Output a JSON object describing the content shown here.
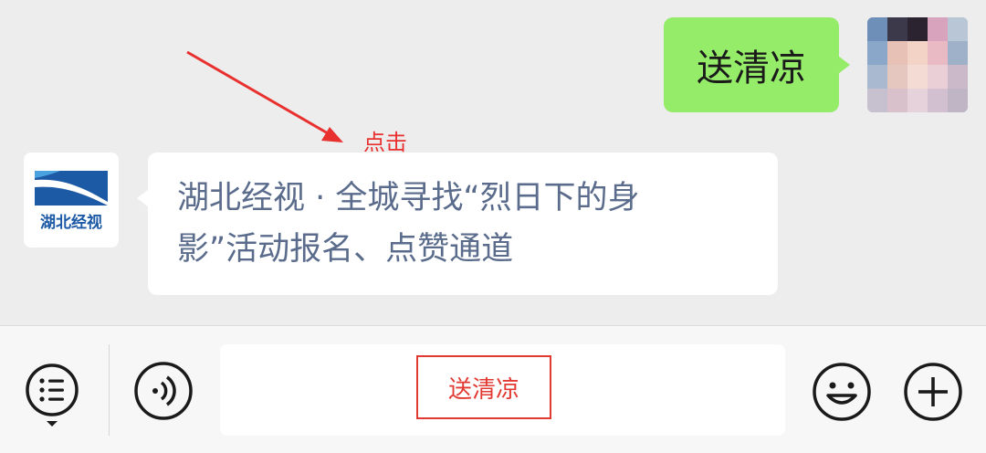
{
  "chat": {
    "outgoing_message": "送清凉",
    "incoming_message_line1": "湖北经视 · 全城寻找“烈日下的身",
    "incoming_message_line2": "影”活动报名、点赞通道",
    "official_account_logo_text": "湖北经视"
  },
  "annotation": {
    "label": "点击",
    "color": "#e8312f"
  },
  "input": {
    "value": "送清凉"
  },
  "colors": {
    "background": "#ededed",
    "outgoing_bubble": "#95ec69",
    "incoming_bubble": "#ffffff",
    "link_text": "#5a6b8c"
  },
  "icons": {
    "menu": "menu-list-icon",
    "voice": "voice-icon",
    "emoji": "emoji-smile-icon",
    "plus": "plus-icon"
  }
}
